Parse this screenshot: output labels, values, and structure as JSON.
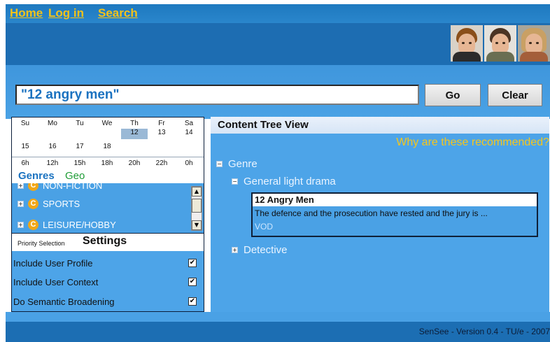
{
  "nav": {
    "home": "Home",
    "login": "Log in",
    "search": "Search"
  },
  "header": {
    "portraits": [
      "user-portrait-1",
      "user-portrait-2",
      "user-portrait-3"
    ]
  },
  "search": {
    "value": "\"12 angry men\"",
    "go_label": "Go",
    "clear_label": "Clear"
  },
  "calendar": {
    "days": [
      "Su",
      "Mo",
      "Tu",
      "We",
      "Th",
      "Fr",
      "Sa"
    ],
    "row1": [
      "",
      "",
      "",
      "",
      "12",
      "13",
      "14"
    ],
    "row2": [
      "15",
      "16",
      "17",
      "18",
      "",
      "",
      ""
    ],
    "hours": [
      "6h",
      "12h",
      "15h",
      "18h",
      "20h",
      "22h",
      "0h"
    ],
    "selected_date": "12"
  },
  "genres": {
    "tab_genres": "Genres",
    "tab_geo": "Geo",
    "items": [
      {
        "label": "NON-FICTION",
        "icon": "category-c-icon"
      },
      {
        "label": "SPORTS",
        "icon": "category-c-icon"
      },
      {
        "label": "LEISURE/HOBBY",
        "icon": "category-c-icon"
      }
    ]
  },
  "settings": {
    "priority_label": "Priority Selection",
    "settings_label": "Settings",
    "options": [
      {
        "label": "Include User Profile",
        "checked": true
      },
      {
        "label": "Include User Context",
        "checked": true
      },
      {
        "label": "Do Semantic Broadening",
        "checked": true
      }
    ]
  },
  "content_tree": {
    "header": "Content Tree View",
    "why_label": "Why are these recommended?",
    "root": "Genre",
    "child": "General light drama",
    "card": {
      "title": "12 Angry Men",
      "description": "The defence and the prosecution have rested and the jury is ...",
      "source": "VOD"
    },
    "sibling": "Detective"
  },
  "footer": {
    "text": "SenSee - Version 0.4 - TU/e - 2007"
  },
  "colors": {
    "link": "#f3c21a",
    "header_blue": "#1d6db2",
    "panel_blue": "#4da4e8",
    "genre_tab": "#1a72c0",
    "geo_tab": "#1e9c36"
  }
}
